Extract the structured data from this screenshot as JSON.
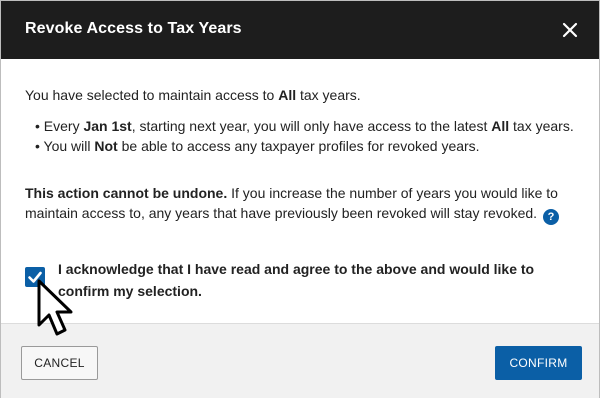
{
  "dialog": {
    "title": "Revoke Access to Tax Years",
    "close_icon": "close-icon"
  },
  "body": {
    "intro_prefix": "You have selected to maintain access to ",
    "intro_bold": "All",
    "intro_suffix": " tax years.",
    "bullet1_prefix": "• Every ",
    "bullet1_bold1": "Jan 1st",
    "bullet1_mid": ", starting next year, you will only have access to the latest ",
    "bullet1_bold2": "All",
    "bullet1_suffix": " tax years.",
    "bullet2_prefix": "• You will ",
    "bullet2_bold": "Not",
    "bullet2_suffix": " be able to access any taxpayer profiles for revoked years.",
    "warning_bold": "This action cannot be undone.",
    "warning_text": " If you increase the number of years you would like to maintain access to, any years that have previously been revoked will stay revoked.",
    "help_icon": "?",
    "acknowledge_text": "I acknowledge that I have read and agree to the above and would like to confirm my selection.",
    "acknowledge_checked": true
  },
  "footer": {
    "cancel_label": "CANCEL",
    "confirm_label": "CONFIRM"
  },
  "colors": {
    "titlebar": "#1d1d1d",
    "accent": "#0b5fa6",
    "footer": "#f1f1f1"
  }
}
